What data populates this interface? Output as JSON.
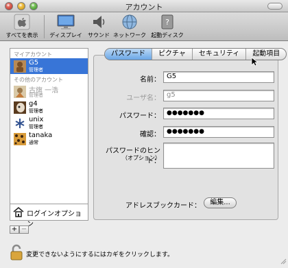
{
  "window": {
    "title": "アカウント"
  },
  "toolbar": {
    "items": [
      {
        "label": "すべてを表示",
        "icon": "apple-logo-icon"
      },
      {
        "label": "ディスプレイ",
        "icon": "display-icon"
      },
      {
        "label": "サウンド",
        "icon": "speaker-icon"
      },
      {
        "label": "ネットワーク",
        "icon": "network-globe-icon"
      },
      {
        "label": "起動ディスク",
        "icon": "startup-disk-icon"
      }
    ]
  },
  "sidebar": {
    "my_account_heading": "マイアカウント",
    "other_accounts_heading": "その他のアカウント",
    "accounts": [
      {
        "name": "G5",
        "role": "管理者",
        "selected": true
      },
      {
        "name": "古旗 一浩",
        "role": "管理者",
        "disabled": true
      },
      {
        "name": "g4",
        "role": "管理者"
      },
      {
        "name": "unix",
        "role": "管理者"
      },
      {
        "name": "tanaka",
        "role": "通常"
      }
    ],
    "login_options_label": "ログインオプション",
    "add_label": "+",
    "remove_label": "−"
  },
  "tabs": [
    {
      "label": "パスワード",
      "active": true
    },
    {
      "label": "ピクチャ"
    },
    {
      "label": "セキュリティ"
    },
    {
      "label": "起動項目"
    }
  ],
  "form": {
    "name_label": "名前：",
    "name_value": "G5",
    "short_name_label": "ユーザ名：",
    "short_name_value": "g5",
    "password_label": "パスワード：",
    "password_value": "●●●●●●●",
    "verify_label": "確認：",
    "verify_value": "●●●●●●●",
    "hint_label": "パスワードのヒント：",
    "hint_sub_label": "（オプション）",
    "hint_value": "",
    "addressbook_label": "アドレスブックカード：",
    "edit_button_label": "編集..."
  },
  "footer": {
    "lock_text": "変更できないようにするにはカギをクリックします。"
  }
}
